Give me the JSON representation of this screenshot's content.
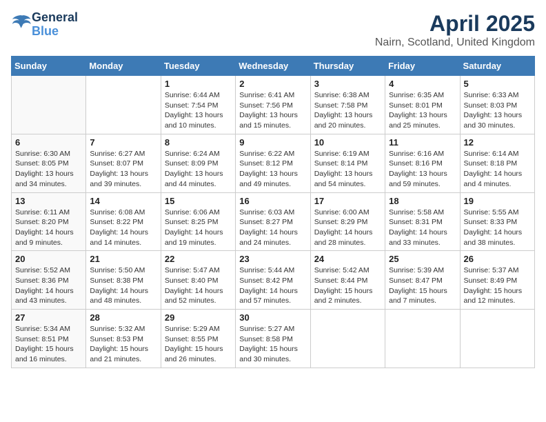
{
  "header": {
    "logo_line1": "General",
    "logo_line2": "Blue",
    "title": "April 2025",
    "subtitle": "Nairn, Scotland, United Kingdom"
  },
  "weekdays": [
    "Sunday",
    "Monday",
    "Tuesday",
    "Wednesday",
    "Thursday",
    "Friday",
    "Saturday"
  ],
  "weeks": [
    [
      {
        "day": "",
        "info": ""
      },
      {
        "day": "",
        "info": ""
      },
      {
        "day": "1",
        "info": "Sunrise: 6:44 AM\nSunset: 7:54 PM\nDaylight: 13 hours\nand 10 minutes."
      },
      {
        "day": "2",
        "info": "Sunrise: 6:41 AM\nSunset: 7:56 PM\nDaylight: 13 hours\nand 15 minutes."
      },
      {
        "day": "3",
        "info": "Sunrise: 6:38 AM\nSunset: 7:58 PM\nDaylight: 13 hours\nand 20 minutes."
      },
      {
        "day": "4",
        "info": "Sunrise: 6:35 AM\nSunset: 8:01 PM\nDaylight: 13 hours\nand 25 minutes."
      },
      {
        "day": "5",
        "info": "Sunrise: 6:33 AM\nSunset: 8:03 PM\nDaylight: 13 hours\nand 30 minutes."
      }
    ],
    [
      {
        "day": "6",
        "info": "Sunrise: 6:30 AM\nSunset: 8:05 PM\nDaylight: 13 hours\nand 34 minutes."
      },
      {
        "day": "7",
        "info": "Sunrise: 6:27 AM\nSunset: 8:07 PM\nDaylight: 13 hours\nand 39 minutes."
      },
      {
        "day": "8",
        "info": "Sunrise: 6:24 AM\nSunset: 8:09 PM\nDaylight: 13 hours\nand 44 minutes."
      },
      {
        "day": "9",
        "info": "Sunrise: 6:22 AM\nSunset: 8:12 PM\nDaylight: 13 hours\nand 49 minutes."
      },
      {
        "day": "10",
        "info": "Sunrise: 6:19 AM\nSunset: 8:14 PM\nDaylight: 13 hours\nand 54 minutes."
      },
      {
        "day": "11",
        "info": "Sunrise: 6:16 AM\nSunset: 8:16 PM\nDaylight: 13 hours\nand 59 minutes."
      },
      {
        "day": "12",
        "info": "Sunrise: 6:14 AM\nSunset: 8:18 PM\nDaylight: 14 hours\nand 4 minutes."
      }
    ],
    [
      {
        "day": "13",
        "info": "Sunrise: 6:11 AM\nSunset: 8:20 PM\nDaylight: 14 hours\nand 9 minutes."
      },
      {
        "day": "14",
        "info": "Sunrise: 6:08 AM\nSunset: 8:22 PM\nDaylight: 14 hours\nand 14 minutes."
      },
      {
        "day": "15",
        "info": "Sunrise: 6:06 AM\nSunset: 8:25 PM\nDaylight: 14 hours\nand 19 minutes."
      },
      {
        "day": "16",
        "info": "Sunrise: 6:03 AM\nSunset: 8:27 PM\nDaylight: 14 hours\nand 24 minutes."
      },
      {
        "day": "17",
        "info": "Sunrise: 6:00 AM\nSunset: 8:29 PM\nDaylight: 14 hours\nand 28 minutes."
      },
      {
        "day": "18",
        "info": "Sunrise: 5:58 AM\nSunset: 8:31 PM\nDaylight: 14 hours\nand 33 minutes."
      },
      {
        "day": "19",
        "info": "Sunrise: 5:55 AM\nSunset: 8:33 PM\nDaylight: 14 hours\nand 38 minutes."
      }
    ],
    [
      {
        "day": "20",
        "info": "Sunrise: 5:52 AM\nSunset: 8:36 PM\nDaylight: 14 hours\nand 43 minutes."
      },
      {
        "day": "21",
        "info": "Sunrise: 5:50 AM\nSunset: 8:38 PM\nDaylight: 14 hours\nand 48 minutes."
      },
      {
        "day": "22",
        "info": "Sunrise: 5:47 AM\nSunset: 8:40 PM\nDaylight: 14 hours\nand 52 minutes."
      },
      {
        "day": "23",
        "info": "Sunrise: 5:44 AM\nSunset: 8:42 PM\nDaylight: 14 hours\nand 57 minutes."
      },
      {
        "day": "24",
        "info": "Sunrise: 5:42 AM\nSunset: 8:44 PM\nDaylight: 15 hours\nand 2 minutes."
      },
      {
        "day": "25",
        "info": "Sunrise: 5:39 AM\nSunset: 8:47 PM\nDaylight: 15 hours\nand 7 minutes."
      },
      {
        "day": "26",
        "info": "Sunrise: 5:37 AM\nSunset: 8:49 PM\nDaylight: 15 hours\nand 12 minutes."
      }
    ],
    [
      {
        "day": "27",
        "info": "Sunrise: 5:34 AM\nSunset: 8:51 PM\nDaylight: 15 hours\nand 16 minutes."
      },
      {
        "day": "28",
        "info": "Sunrise: 5:32 AM\nSunset: 8:53 PM\nDaylight: 15 hours\nand 21 minutes."
      },
      {
        "day": "29",
        "info": "Sunrise: 5:29 AM\nSunset: 8:55 PM\nDaylight: 15 hours\nand 26 minutes."
      },
      {
        "day": "30",
        "info": "Sunrise: 5:27 AM\nSunset: 8:58 PM\nDaylight: 15 hours\nand 30 minutes."
      },
      {
        "day": "",
        "info": ""
      },
      {
        "day": "",
        "info": ""
      },
      {
        "day": "",
        "info": ""
      }
    ]
  ]
}
